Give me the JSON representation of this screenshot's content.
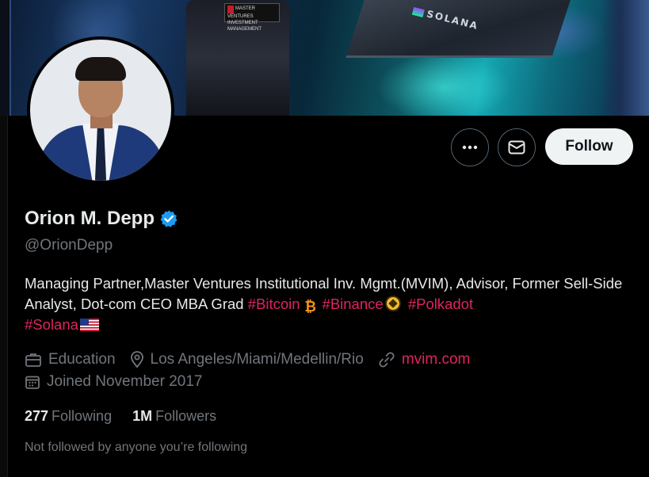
{
  "banner": {
    "badge_text": "MASTER VENTURES INVESTMENT MANAGEMENT",
    "ship_text": "SOLANA"
  },
  "actions": {
    "more_icon": "more-dots-icon",
    "message_icon": "mail-icon",
    "follow_label": "Follow"
  },
  "profile": {
    "display_name": "Orion M. Depp",
    "verified_icon": "verified-badge-icon",
    "verified_color": "#1d9bf0",
    "handle": "@OrionDepp",
    "bio_text": "Managing Partner,Master Ventures Institutional Inv. Mgmt.(MVIM), Advisor, Former Sell-Side Analyst, Dot-com CEO MBA Grad ",
    "hashtags": [
      "#Bitcoin",
      "#Binance",
      "#Polkadot",
      "#Solana"
    ],
    "hashtag_color": "#e0245e",
    "category": "Education",
    "location": "Los Angeles/Miami/Medellin/Rio",
    "website": "mvim.com",
    "joined": "Joined November 2017",
    "following_count": "277",
    "following_label": "Following",
    "followers_count": "1M",
    "followers_label": "Followers",
    "not_followed_text": "Not followed by anyone you’re following"
  }
}
